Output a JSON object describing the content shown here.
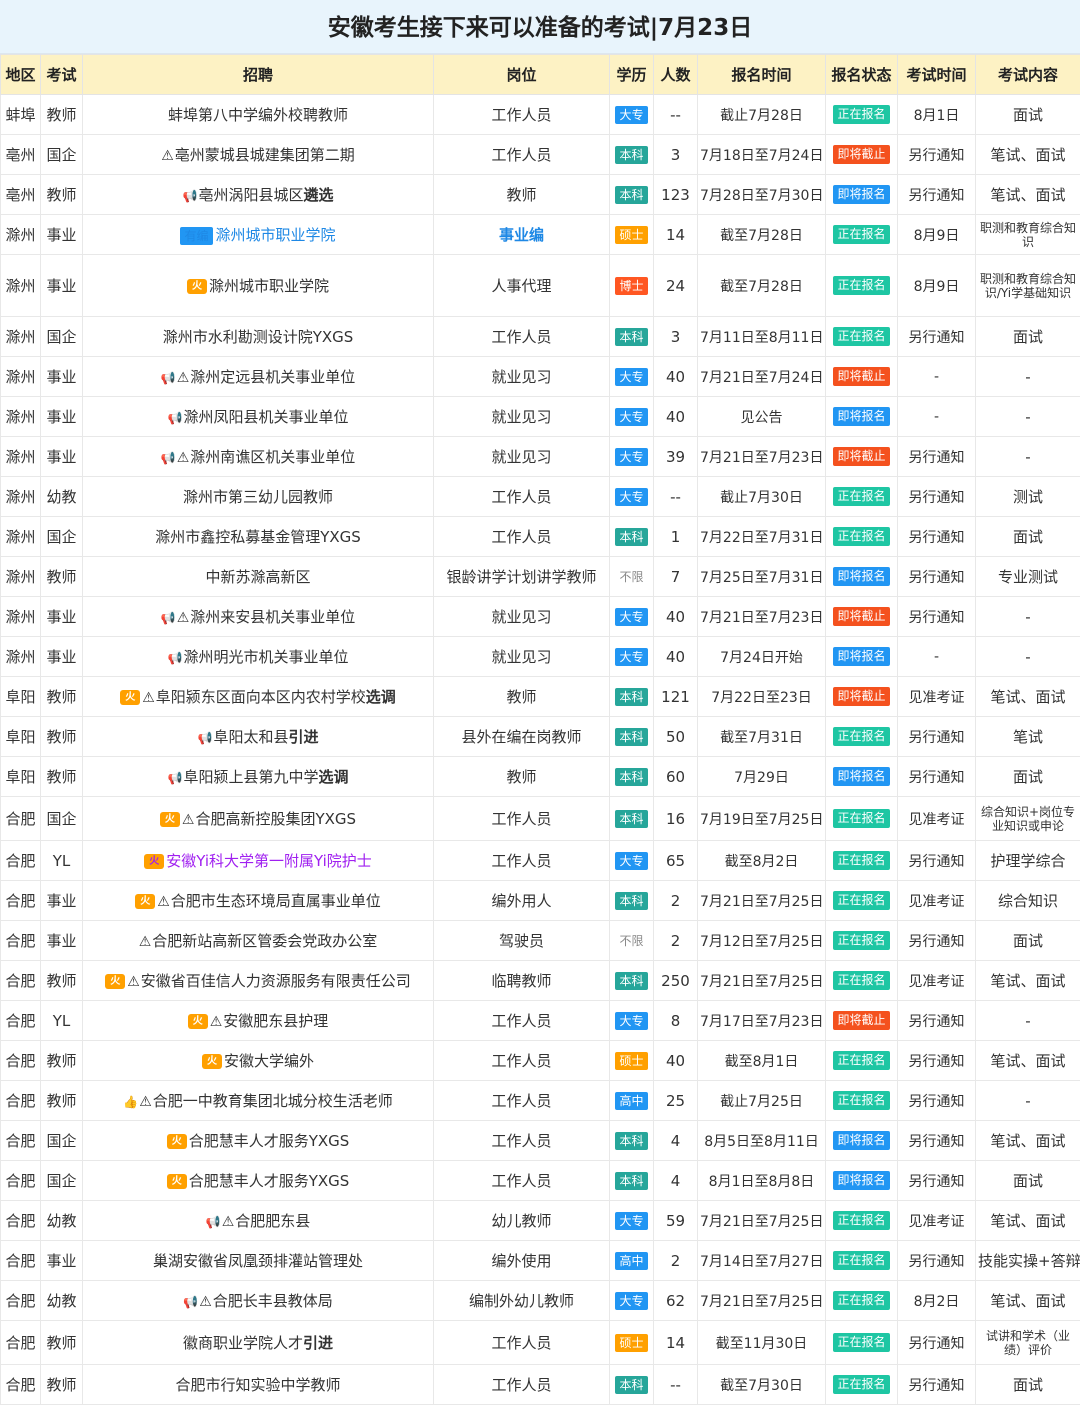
{
  "title": "安徽考生接下来可以准备的考试|7月23日",
  "headers": [
    "地区",
    "考试",
    "招聘",
    "岗位",
    "学历",
    "人数",
    "报名时间",
    "报名状态",
    "考试时间",
    "考试内容"
  ],
  "colors": {
    "大专": "#2196f3",
    "本科": "#26a69a",
    "硕士": "#ffa000",
    "博士": "#ff5722",
    "高中": "#2196f3",
    "不限": "#ffffff",
    "正在报名": "#1ec6a3",
    "即将截止": "#f4511e",
    "即将报名": "#2196f3"
  },
  "rows": [
    {
      "region": "蚌埠",
      "type": "教师",
      "icon": "",
      "warn": false,
      "recruit": "蚌埠第八中学编外校聘教师",
      "em": "",
      "post": "工作人员",
      "edu": "大专",
      "num": "--",
      "time": "截止7月28日",
      "status": "正在报名",
      "date": "8月1日",
      "content": "面试"
    },
    {
      "region": "亳州",
      "type": "国企",
      "icon": "",
      "warn": true,
      "recruit": "亳州蒙城县城建集团第二期",
      "em": "",
      "post": "工作人员",
      "edu": "本科",
      "num": "3",
      "time": "7月18日至7月24日",
      "status": "即将截止",
      "date": "另行通知",
      "content": "笔试、面试"
    },
    {
      "region": "亳州",
      "type": "教师",
      "icon": "megaphone-icon",
      "warn": false,
      "recruit": "亳州涡阳县城区",
      "em": "遴选",
      "post": "教师",
      "edu": "本科",
      "num": "123",
      "time": "7月28日至7月30日",
      "status": "即将报名",
      "date": "另行通知",
      "content": "笔试、面试"
    },
    {
      "region": "滁州",
      "type": "事业",
      "icon": "youbian-tag",
      "tag": "有编",
      "warn": false,
      "recruit": "滁州城市职业学院",
      "em": "",
      "post": "事业编",
      "edu": "硕士",
      "num": "14",
      "time": "截至7月28日",
      "status": "正在报名",
      "date": "8月9日",
      "content": "职测和教育综合知识",
      "blue": true
    },
    {
      "region": "滁州",
      "type": "事业",
      "icon": "hot-icon",
      "warn": false,
      "recruit": "滁州城市职业学院",
      "em": "",
      "post": "人事代理",
      "edu": "博士",
      "num": "24",
      "time": "截至7月28日",
      "status": "正在报名",
      "date": "8月9日",
      "content": "职测和教育综合知识/Yi学基础知识",
      "tall": true
    },
    {
      "region": "滁州",
      "type": "国企",
      "icon": "",
      "warn": false,
      "recruit": "滁州市水利勘测设计院YXGS",
      "em": "",
      "post": "工作人员",
      "edu": "本科",
      "num": "3",
      "time": "7月11日至8月11日",
      "status": "正在报名",
      "date": "另行通知",
      "content": "面试"
    },
    {
      "region": "滁州",
      "type": "事业",
      "icon": "megaphone-icon",
      "warn": true,
      "recruit": "滁州定远县机关事业单位",
      "em": "",
      "post": "就业见习",
      "edu": "大专",
      "num": "40",
      "time": "7月21日至7月24日",
      "status": "即将截止",
      "date": "-",
      "content": "-"
    },
    {
      "region": "滁州",
      "type": "事业",
      "icon": "megaphone-icon",
      "warn": false,
      "recruit": "滁州凤阳县机关事业单位",
      "em": "",
      "post": "就业见习",
      "edu": "大专",
      "num": "40",
      "time": "见公告",
      "status": "即将报名",
      "date": "-",
      "content": "-"
    },
    {
      "region": "滁州",
      "type": "事业",
      "icon": "megaphone-icon",
      "warn": true,
      "recruit": "滁州南谯区机关事业单位",
      "em": "",
      "post": "就业见习",
      "edu": "大专",
      "num": "39",
      "time": "7月21日至7月23日",
      "status": "即将截止",
      "date": "另行通知",
      "content": "-"
    },
    {
      "region": "滁州",
      "type": "幼教",
      "icon": "",
      "warn": false,
      "recruit": "滁州市第三幼儿园教师",
      "em": "",
      "post": "工作人员",
      "edu": "大专",
      "num": "--",
      "time": "截止7月30日",
      "status": "正在报名",
      "date": "另行通知",
      "content": "测试"
    },
    {
      "region": "滁州",
      "type": "国企",
      "icon": "",
      "warn": false,
      "recruit": "滁州市鑫控私募基金管理YXGS",
      "em": "",
      "post": "工作人员",
      "edu": "本科",
      "num": "1",
      "time": "7月22日至7月31日",
      "status": "正在报名",
      "date": "另行通知",
      "content": "面试"
    },
    {
      "region": "滁州",
      "type": "教师",
      "icon": "",
      "warn": false,
      "recruit": "中新苏滁高新区",
      "em": "",
      "post": "银龄讲学计划讲学教师",
      "edu": "不限",
      "num": "7",
      "time": "7月25日至7月31日",
      "status": "即将报名",
      "date": "另行通知",
      "content": "专业测试"
    },
    {
      "region": "滁州",
      "type": "事业",
      "icon": "megaphone-icon",
      "warn": true,
      "recruit": "滁州来安县机关事业单位",
      "em": "",
      "post": "就业见习",
      "edu": "大专",
      "num": "40",
      "time": "7月21日至7月23日",
      "status": "即将截止",
      "date": "另行通知",
      "content": "-"
    },
    {
      "region": "滁州",
      "type": "事业",
      "icon": "megaphone-icon",
      "warn": false,
      "recruit": "滁州明光市机关事业单位",
      "em": "",
      "post": "就业见习",
      "edu": "大专",
      "num": "40",
      "time": "7月24日开始",
      "status": "即将报名",
      "date": "-",
      "content": "-"
    },
    {
      "region": "阜阳",
      "type": "教师",
      "icon": "hot-icon",
      "warn": true,
      "recruit": "阜阳颍东区面向本区内农村学校",
      "em": "选调",
      "post": "教师",
      "edu": "本科",
      "num": "121",
      "time": "7月22日至23日",
      "status": "即将截止",
      "date": "见准考证",
      "content": "笔试、面试"
    },
    {
      "region": "阜阳",
      "type": "教师",
      "icon": "megaphone-icon",
      "warn": false,
      "recruit": "阜阳太和县",
      "em": "引进",
      "post": "县外在编在岗教师",
      "edu": "本科",
      "num": "50",
      "time": "截至7月31日",
      "status": "正在报名",
      "date": "另行通知",
      "content": "笔试"
    },
    {
      "region": "阜阳",
      "type": "教师",
      "icon": "megaphone-icon",
      "warn": false,
      "recruit": "阜阳颍上县第九中学",
      "em": "选调",
      "post": "教师",
      "edu": "本科",
      "num": "60",
      "time": "7月29日",
      "status": "即将报名",
      "date": "另行通知",
      "content": "面试"
    },
    {
      "region": "合肥",
      "type": "国企",
      "icon": "hot-icon",
      "warn": true,
      "recruit": "合肥高新控股集团YXGS",
      "em": "",
      "post": "工作人员",
      "edu": "本科",
      "num": "16",
      "time": "7月19日至7月25日",
      "status": "正在报名",
      "date": "见准考证",
      "content": "综合知识+岗位专业知识或申论",
      "med": true
    },
    {
      "region": "合肥",
      "type": "YL",
      "icon": "hot-icon",
      "warn": false,
      "recruit": "安徽Yi科大学第一附属Yi院护士",
      "em": "",
      "post": "工作人员",
      "edu": "大专",
      "num": "65",
      "time": "截至8月2日",
      "status": "正在报名",
      "date": "另行通知",
      "content": "护理学综合",
      "purple": true
    },
    {
      "region": "合肥",
      "type": "事业",
      "icon": "hot-icon",
      "warn": true,
      "recruit": "合肥市生态环境局直属事业单位",
      "em": "",
      "post": "编外用人",
      "edu": "本科",
      "num": "2",
      "time": "7月21日至7月25日",
      "status": "正在报名",
      "date": "见准考证",
      "content": "综合知识"
    },
    {
      "region": "合肥",
      "type": "事业",
      "icon": "",
      "warn": true,
      "recruit": "合肥新站高新区管委会党政办公室",
      "em": "",
      "post": "驾驶员",
      "edu": "不限",
      "num": "2",
      "time": "7月12日至7月25日",
      "status": "正在报名",
      "date": "另行通知",
      "content": "面试"
    },
    {
      "region": "合肥",
      "type": "教师",
      "icon": "hot-icon",
      "warn": true,
      "recruit": "安徽省百佳信人力资源服务有限责任公司",
      "em": "",
      "post": "临聘教师",
      "edu": "本科",
      "num": "250",
      "time": "7月21日至7月25日",
      "status": "正在报名",
      "date": "见准考证",
      "content": "笔试、面试"
    },
    {
      "region": "合肥",
      "type": "YL",
      "icon": "hot-icon",
      "warn": true,
      "recruit": "安徽肥东县护理",
      "em": "",
      "post": "工作人员",
      "edu": "大专",
      "num": "8",
      "time": "7月17日至7月23日",
      "status": "即将截止",
      "date": "另行通知",
      "content": "-"
    },
    {
      "region": "合肥",
      "type": "教师",
      "icon": "hot-icon",
      "warn": false,
      "recruit": "安徽大学编外",
      "em": "",
      "post": "工作人员",
      "edu": "硕士",
      "num": "40",
      "time": "截至8月1日",
      "status": "正在报名",
      "date": "另行通知",
      "content": "笔试、面试"
    },
    {
      "region": "合肥",
      "type": "教师",
      "icon": "thumb-icon",
      "warn": true,
      "recruit": "合肥一中教育集团北城分校生活老师",
      "em": "",
      "post": "工作人员",
      "edu": "高中",
      "num": "25",
      "time": "截止7月25日",
      "status": "正在报名",
      "date": "另行通知",
      "content": "-"
    },
    {
      "region": "合肥",
      "type": "国企",
      "icon": "hot-icon",
      "warn": false,
      "recruit": "合肥慧丰人才服务YXGS",
      "em": "",
      "post": "工作人员",
      "edu": "本科",
      "num": "4",
      "time": "8月5日至8月11日",
      "status": "即将报名",
      "date": "另行通知",
      "content": "笔试、面试"
    },
    {
      "region": "合肥",
      "type": "国企",
      "icon": "hot-icon",
      "warn": false,
      "recruit": "合肥慧丰人才服务YXGS",
      "em": "",
      "post": "工作人员",
      "edu": "本科",
      "num": "4",
      "time": "8月1日至8月8日",
      "status": "即将报名",
      "date": "另行通知",
      "content": "面试"
    },
    {
      "region": "合肥",
      "type": "幼教",
      "icon": "megaphone-icon",
      "warn": true,
      "recruit": "合肥肥东县",
      "em": "",
      "post": "幼儿教师",
      "edu": "大专",
      "num": "59",
      "time": "7月21日至7月25日",
      "status": "正在报名",
      "date": "见准考证",
      "content": "笔试、面试"
    },
    {
      "region": "合肥",
      "type": "事业",
      "icon": "",
      "warn": false,
      "recruit": "巢湖安徽省凤凰颈排灌站管理处",
      "em": "",
      "post": "编外使用",
      "edu": "高中",
      "num": "2",
      "time": "7月14日至7月27日",
      "status": "正在报名",
      "date": "另行通知",
      "content": "技能实操+答辩"
    },
    {
      "region": "合肥",
      "type": "幼教",
      "icon": "megaphone-icon",
      "warn": true,
      "recruit": "合肥长丰县教体局",
      "em": "",
      "post": "编制外幼儿教师",
      "edu": "大专",
      "num": "62",
      "time": "7月21日至7月25日",
      "status": "正在报名",
      "date": "8月2日",
      "content": "笔试、面试"
    },
    {
      "region": "合肥",
      "type": "教师",
      "icon": "",
      "warn": false,
      "recruit": "徽商职业学院人才",
      "em": "引进",
      "post": "工作人员",
      "edu": "硕士",
      "num": "14",
      "time": "截至11月30日",
      "status": "正在报名",
      "date": "另行通知",
      "content": "试讲和学术（业绩）评价",
      "med": true
    },
    {
      "region": "合肥",
      "type": "教师",
      "icon": "",
      "warn": false,
      "recruit": "合肥市行知实验中学教师",
      "em": "",
      "post": "工作人员",
      "edu": "本科",
      "num": "--",
      "time": "截至7月30日",
      "status": "正在报名",
      "date": "另行通知",
      "content": "面试"
    }
  ]
}
